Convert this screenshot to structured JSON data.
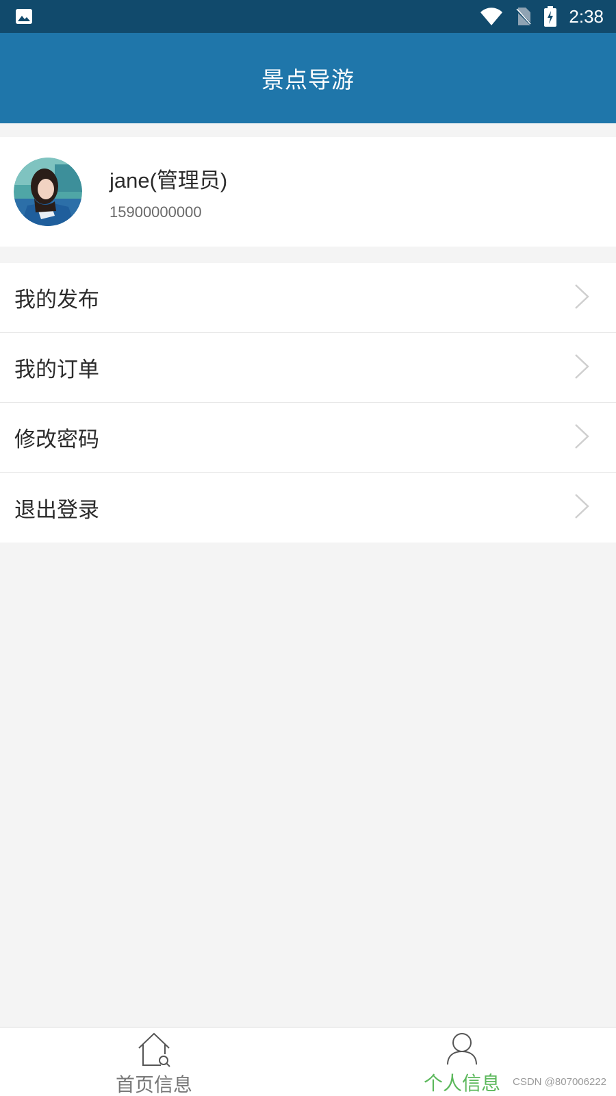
{
  "status_bar": {
    "time": "2:38",
    "icons": [
      "image-icon",
      "wifi-icon",
      "no-sim-icon",
      "battery-charging-icon"
    ]
  },
  "header": {
    "title": "景点导游"
  },
  "profile": {
    "name": "jane(管理员)",
    "phone": "15900000000"
  },
  "menu": {
    "items": [
      {
        "label": "我的发布"
      },
      {
        "label": "我的订单"
      },
      {
        "label": "修改密码"
      },
      {
        "label": "退出登录"
      }
    ]
  },
  "bottom_nav": {
    "tabs": [
      {
        "label": "首页信息",
        "icon": "home-search-icon",
        "active": false
      },
      {
        "label": "个人信息",
        "icon": "person-icon",
        "active": true
      }
    ]
  },
  "watermark": "CSDN @807006222",
  "colors": {
    "status_bar": "#114a6c",
    "header": "#1f76aa",
    "active_tab": "#5cb85c",
    "inactive_tab": "#777777",
    "background": "#f4f4f4"
  }
}
